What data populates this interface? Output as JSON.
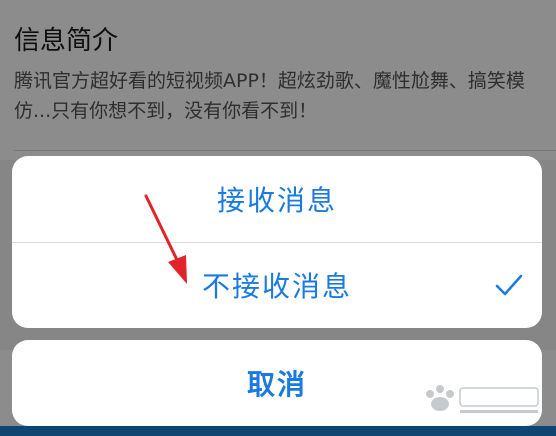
{
  "background": {
    "section_title": "信息简介",
    "description": "腾讯官方超好看的短视频APP！超炫劲歌、魔性尬舞、搞笑模仿...只有你想不到，没有你看不到！"
  },
  "action_sheet": {
    "options": [
      {
        "label": "接收消息",
        "selected": false
      },
      {
        "label": "不接收消息",
        "selected": true
      }
    ],
    "cancel_label": "取消",
    "accent_color": "#1a7ae0"
  },
  "annotation": {
    "arrow_color": "#e0242a",
    "icon": "red-arrow-icon"
  },
  "watermark": {
    "icon": "baidu-jingyan-watermark-icon"
  }
}
